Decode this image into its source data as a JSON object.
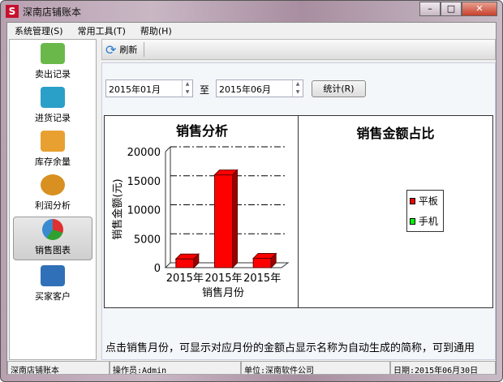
{
  "window": {
    "title": "深南店铺账本",
    "logo": "S",
    "min": "–",
    "max": "□",
    "close": "✕"
  },
  "menu": [
    "系统管理(S)",
    "常用工具(T)",
    "帮助(H)"
  ],
  "sidebar": [
    {
      "label": "卖出记录",
      "color": "#6bb84a"
    },
    {
      "label": "进货记录",
      "color": "#2aa0c8"
    },
    {
      "label": "库存余量",
      "color": "#e8a030"
    },
    {
      "label": "利润分析",
      "color": "#d89020"
    },
    {
      "label": "销售图表",
      "color": "#3a8ad0"
    },
    {
      "label": "买家客户",
      "color": "#3070b8"
    }
  ],
  "toolbar": {
    "refresh": "刷新"
  },
  "filter": {
    "from": "2015年01月",
    "to_label": "至",
    "to": "2015年06月",
    "button": "统计(R)"
  },
  "chart_data": [
    {
      "type": "bar",
      "title": "销售分析",
      "xlabel": "销售月份",
      "ylabel": "销售金额(元)",
      "categories": [
        "2015年",
        "2015年",
        "2015年"
      ],
      "values": [
        1500,
        16000,
        1600
      ],
      "ylim": [
        0,
        20000
      ],
      "yticks": [
        "0",
        "5000",
        "10000",
        "15000",
        "20000"
      ],
      "color": "#ff0000"
    },
    {
      "type": "pie",
      "title": "销售金额占比",
      "legend": [
        {
          "name": "平板",
          "color": "#ff0000"
        },
        {
          "name": "手机",
          "color": "#00ff00"
        }
      ]
    }
  ],
  "note": "点击销售月份，可显示对应月份的金额占显示名称为自动生成的简称，可到通用",
  "status": [
    "深南店铺账本",
    "操作员:Admin",
    "单位:深南软件公司",
    "日期:2015年06月30日"
  ]
}
